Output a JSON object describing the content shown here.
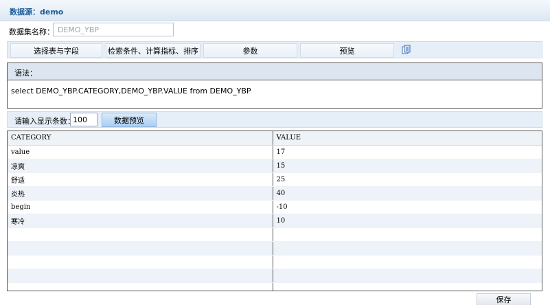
{
  "header": {
    "title": "数据源：demo"
  },
  "dataset": {
    "label": "数据集名称：",
    "value": "DEMO_YBP"
  },
  "tabs": [
    {
      "label": "选择表与字段"
    },
    {
      "label": "检索条件、计算指标、排序"
    },
    {
      "label": "参数"
    },
    {
      "label": "预览"
    }
  ],
  "tab_icon": "export-icon",
  "syntax": {
    "label": "语法：",
    "sql": "select DEMO_YBP.CATEGORY,DEMO_YBP.VALUE from DEMO_YBP"
  },
  "preview": {
    "label": "请输入显示条数：",
    "count": "100",
    "button": "数据预览"
  },
  "table": {
    "columns": [
      "CATEGORY",
      "VALUE"
    ],
    "rows": [
      [
        "value",
        "17"
      ],
      [
        "凉爽",
        "15"
      ],
      [
        "舒适",
        "25"
      ],
      [
        "炎热",
        "40"
      ],
      [
        "begin",
        "-10"
      ],
      [
        "寒冷",
        "10"
      ]
    ]
  },
  "footer": {
    "save": "保存"
  }
}
